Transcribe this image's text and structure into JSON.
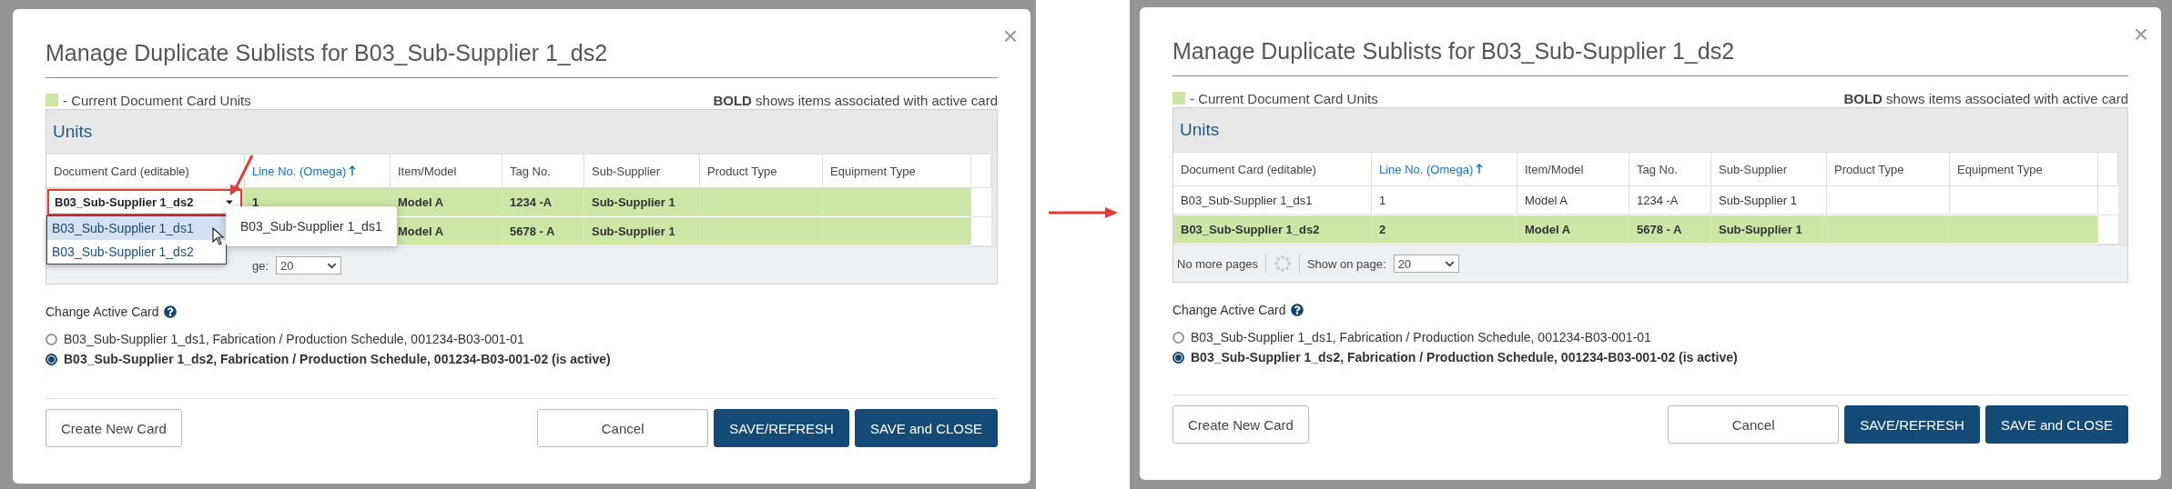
{
  "dialogs": [
    {
      "title": "Manage Duplicate Sublists for B03_Sub-Supplier 1_ds2",
      "close": "×",
      "legend": "- Current Document Card Units",
      "bold_note": "**BOLD** shows items associated with active card",
      "table": {
        "title": "Units",
        "columns": [
          {
            "label": "Document Card (editable)",
            "sorted": false
          },
          {
            "label": "Line No. (Omega)",
            "sorted": true
          },
          {
            "label": "Item/Model",
            "sorted": false
          },
          {
            "label": "Tag No.",
            "sorted": false
          },
          {
            "label": "Sub-Supplier",
            "sorted": false
          },
          {
            "label": "Product Type",
            "sorted": false
          },
          {
            "label": "Equipment Type",
            "sorted": false
          }
        ],
        "rows": [
          {
            "current": true,
            "bold": true,
            "cells": {
              "line_no": "1",
              "item_model": "Model A",
              "tag_no": "1234 -A",
              "sub_supplier": "Sub-Supplier 1"
            },
            "editor": {
              "value": "B03_Sub-Supplier 1_ds2",
              "options": [
                {
                  "label": "B03_Sub-Supplier 1_ds1",
                  "highlighted": true
                },
                {
                  "label": "B03_Sub-Supplier 1_ds2",
                  "highlighted": false
                }
              ],
              "tooltip": "B03_Sub-Supplier 1_ds1"
            }
          },
          {
            "current": true,
            "bold": true,
            "cells": {
              "item_model": "Model A",
              "tag_no": "5678 - A",
              "sub_supplier": "Sub-Supplier 1"
            }
          }
        ],
        "pager": {
          "page_size_label": "ge:",
          "page_size": "20"
        }
      },
      "active_card": {
        "label": "Change Active Card",
        "options": [
          {
            "label": "B03_Sub-Supplier 1_ds1, Fabrication / Production Schedule, 001234-B03-001-01",
            "selected": false
          },
          {
            "label": "B03_Sub-Supplier 1_ds2, Fabrication / Production Schedule, 001234-B03-001-02 (is active)",
            "selected": true
          }
        ]
      },
      "buttons": {
        "create": "Create New Card",
        "cancel": "Cancel",
        "save_refresh": "SAVE/REFRESH",
        "save_close": "SAVE and CLOSE"
      }
    },
    {
      "title": "Manage Duplicate Sublists for B03_Sub-Supplier 1_ds2",
      "close": "×",
      "legend": "- Current Document Card Units",
      "bold_note": "**BOLD** shows items associated with active card",
      "table": {
        "title": "Units",
        "columns": [
          {
            "label": "Document Card (editable)",
            "sorted": false
          },
          {
            "label": "Line No. (Omega)",
            "sorted": true
          },
          {
            "label": "Item/Model",
            "sorted": false
          },
          {
            "label": "Tag No.",
            "sorted": false
          },
          {
            "label": "Sub-Supplier",
            "sorted": false
          },
          {
            "label": "Product Type",
            "sorted": false
          },
          {
            "label": "Equipment Type",
            "sorted": false
          }
        ],
        "rows": [
          {
            "current": false,
            "bold": false,
            "cells": {
              "document_card": "B03_Sub-Supplier 1_ds1",
              "line_no": "1",
              "item_model": "Model A",
              "tag_no": "1234 -A",
              "sub_supplier": "Sub-Supplier 1"
            }
          },
          {
            "current": true,
            "bold": true,
            "cells": {
              "document_card": "B03_Sub-Supplier 1_ds2",
              "line_no": "2",
              "item_model": "Model A",
              "tag_no": "5678 - A",
              "sub_supplier": "Sub-Supplier 1"
            }
          }
        ],
        "pager": {
          "status": "No more pages",
          "page_size_label": "Show on page:",
          "page_size": "20"
        }
      },
      "active_card": {
        "label": "Change Active Card",
        "options": [
          {
            "label": "B03_Sub-Supplier 1_ds1, Fabrication / Production Schedule, 001234-B03-001-01",
            "selected": false
          },
          {
            "label": "B03_Sub-Supplier 1_ds2, Fabrication / Production Schedule, 001234-B03-001-02 (is active)",
            "selected": true
          }
        ]
      },
      "buttons": {
        "create": "Create New Card",
        "cancel": "Cancel",
        "save_refresh": "SAVE/REFRESH",
        "save_close": "SAVE and CLOSE"
      }
    }
  ]
}
